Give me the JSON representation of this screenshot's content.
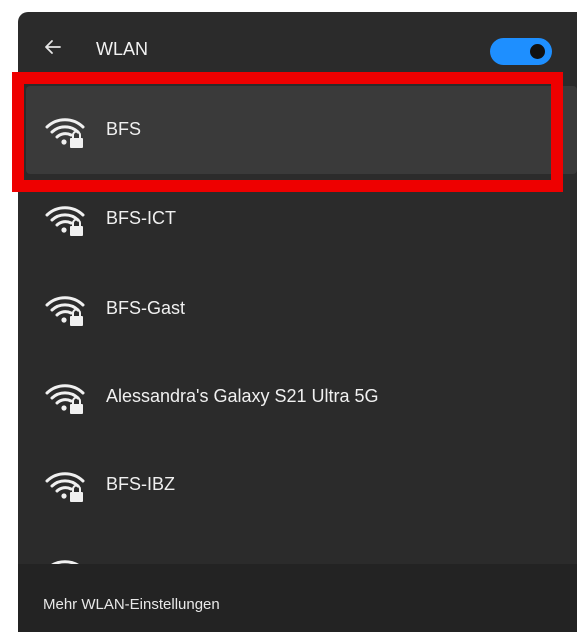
{
  "header": {
    "back_icon": "arrow-left-icon",
    "title": "WLAN",
    "toggle": {
      "state": "on",
      "color": "#1e8fff"
    }
  },
  "networks": [
    {
      "name": "BFS",
      "icon": "wifi-secured-icon",
      "selected": true
    },
    {
      "name": "BFS-ICT",
      "icon": "wifi-secured-icon",
      "selected": false
    },
    {
      "name": "BFS-Gast",
      "icon": "wifi-secured-icon",
      "selected": false
    },
    {
      "name": "Alessandra's Galaxy S21 Ultra 5G",
      "icon": "wifi-secured-icon",
      "selected": false
    },
    {
      "name": "BFS-IBZ",
      "icon": "wifi-secured-icon",
      "selected": false
    },
    {
      "name": "",
      "icon": "wifi-secured-icon",
      "selected": false
    }
  ],
  "footer": {
    "link": "Mehr WLAN-Einstellungen"
  },
  "annotation": {
    "color": "#ee0000",
    "target": "BFS"
  }
}
